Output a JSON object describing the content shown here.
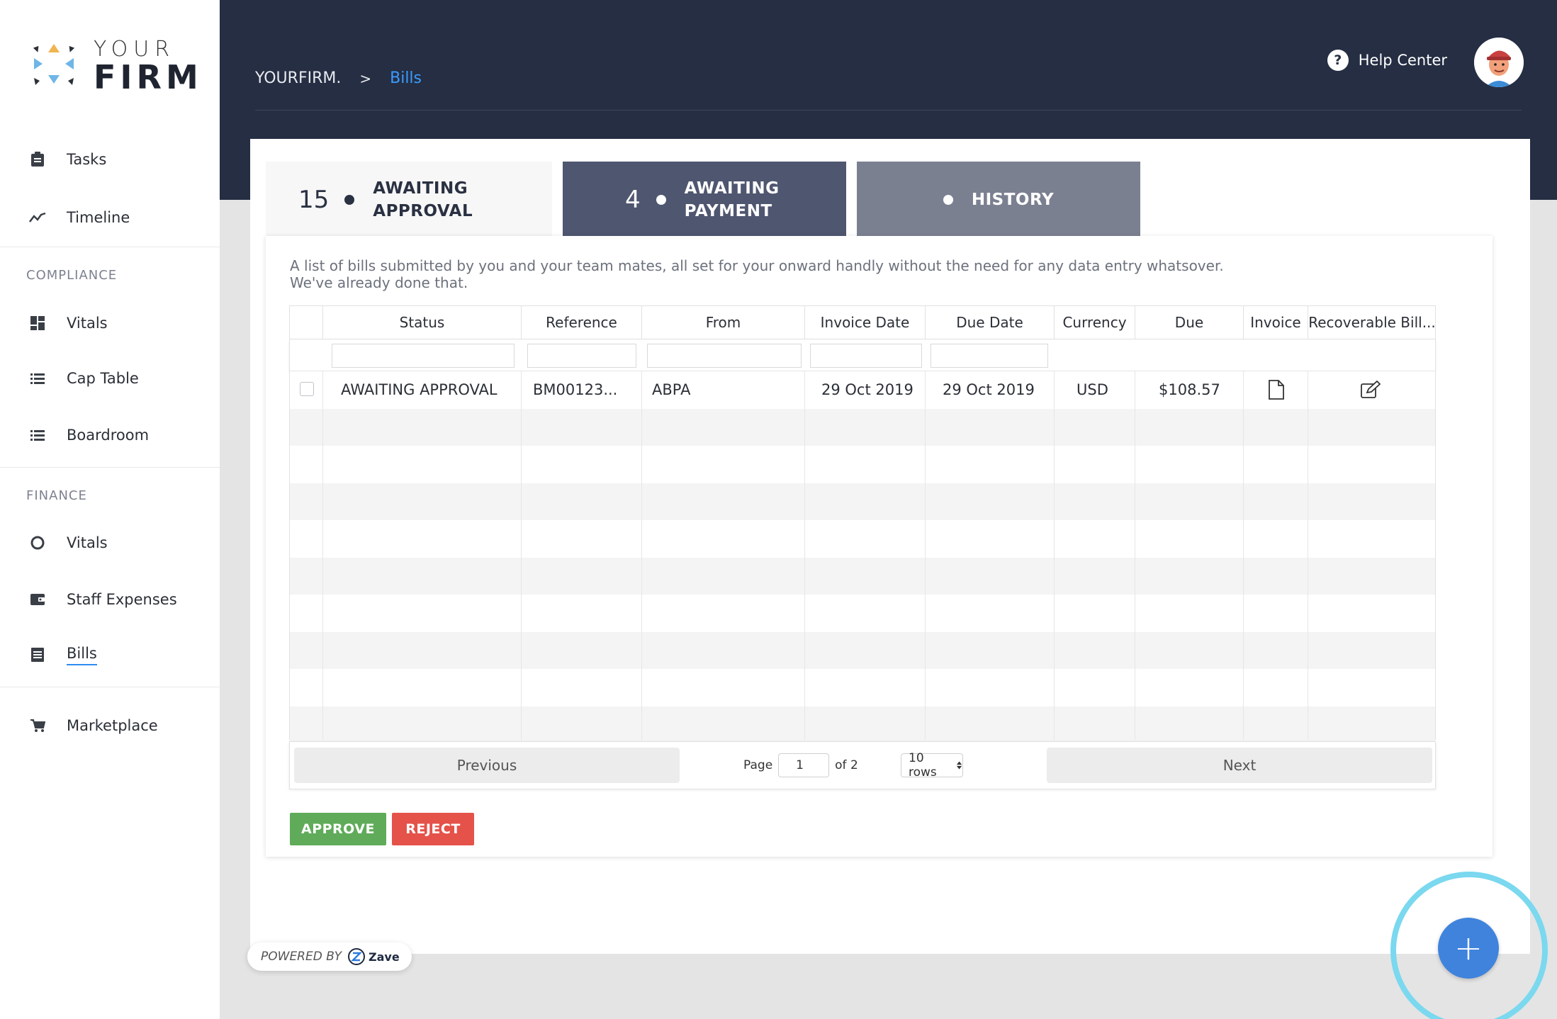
{
  "brand": {
    "top": "YOUR",
    "bottom": "FIRM"
  },
  "sidebar": {
    "items": [
      {
        "label": "Tasks",
        "icon": "clipboard-icon"
      },
      {
        "label": "Timeline",
        "icon": "trend-line-icon"
      },
      {
        "label": "Vitals",
        "icon": "dashboard-grid-icon"
      },
      {
        "label": "Cap Table",
        "icon": "list-icon"
      },
      {
        "label": "Boardroom",
        "icon": "list-icon"
      },
      {
        "label": "Vitals",
        "icon": "ring-icon"
      },
      {
        "label": "Staff Expenses",
        "icon": "wallet-icon"
      },
      {
        "label": "Bills",
        "icon": "document-icon"
      },
      {
        "label": "Marketplace",
        "icon": "cart-icon"
      }
    ],
    "sections": {
      "compliance": "COMPLIANCE",
      "finance": "FINANCE"
    }
  },
  "header": {
    "breadcrumb_root": "YOURFIRM.",
    "breadcrumb_sep": ">",
    "breadcrumb_current": "Bills",
    "help_label": "Help Center",
    "help_glyph": "?"
  },
  "tabs": [
    {
      "count": "15",
      "line1": "AWAITING",
      "line2": "APPROVAL"
    },
    {
      "count": "4",
      "line1": "AWAITING",
      "line2": "PAYMENT"
    },
    {
      "count": "",
      "line1": "HISTORY",
      "line2": ""
    }
  ],
  "description": {
    "line1": "A list of bills submitted by you and your team mates, all set for your onward handly without the need for any data entry whatsover.",
    "line2": "We've already done that."
  },
  "table": {
    "columns": [
      "Status",
      "Reference",
      "From",
      "Invoice Date",
      "Due Date",
      "Currency",
      "Due",
      "Invoice",
      "Recoverable Bill..."
    ],
    "rows": [
      {
        "status": "AWAITING APPROVAL",
        "reference": "BM00123...",
        "from": "ABPA",
        "invoice_date": "29 Oct 2019",
        "due_date": "29 Oct 2019",
        "currency": "USD",
        "due": "$108.57"
      }
    ]
  },
  "pagination": {
    "previous": "Previous",
    "next": "Next",
    "page_label": "Page",
    "page_value": "1",
    "of_label": "of 2",
    "rows_select": "10 rows"
  },
  "actions": {
    "approve": "APPROVE",
    "reject": "REJECT"
  },
  "footer": {
    "powered_by": "POWERED BY",
    "provider": "Zave"
  },
  "fab": {
    "glyph": "+"
  },
  "colors": {
    "header": "#252e43",
    "accent": "#3b9bff",
    "approve": "#5fab59",
    "reject": "#e4524a",
    "fab": "#3f83dd",
    "fab_ring": "#7ad8ef"
  }
}
